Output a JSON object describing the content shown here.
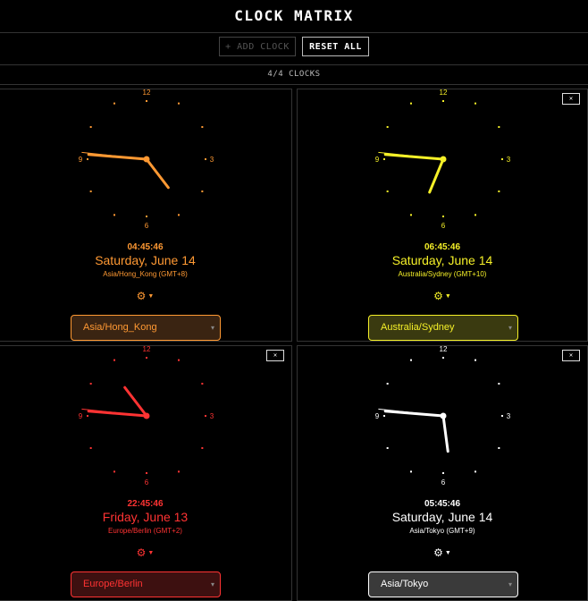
{
  "app": {
    "title": "CLOCK MATRIX"
  },
  "toolbar": {
    "add_label": "+ ADD CLOCK",
    "reset_label": "RESET ALL"
  },
  "status": {
    "count_text": "4/4 CLOCKS"
  },
  "clocks": [
    {
      "time": "04:45:46",
      "date": "Saturday, June 14",
      "zone_label": "Asia/Hong_Kong (GMT+8)",
      "selected_zone": "Asia/Hong_Kong",
      "color": "#ff9933",
      "sel_bg": "#3a2412",
      "hour": 4,
      "minute": 45,
      "second": 46,
      "numerals": {
        "n12": "12",
        "n3": "3",
        "n6": "6",
        "n9": "9"
      }
    },
    {
      "time": "06:45:46",
      "date": "Saturday, June 14",
      "zone_label": "Australia/Sydney (GMT+10)",
      "selected_zone": "Australia/Sydney",
      "color": "#f5f028",
      "sel_bg": "#3a3a10",
      "hour": 6,
      "minute": 45,
      "second": 46,
      "close_label": "✕",
      "numerals": {
        "n12": "12",
        "n3": "3",
        "n6": "6",
        "n9": "9"
      }
    },
    {
      "time": "22:45:46",
      "date": "Friday, June 13",
      "zone_label": "Europe/Berlin (GMT+2)",
      "selected_zone": "Europe/Berlin",
      "color": "#ff3333",
      "sel_bg": "#3d1010",
      "hour": 22,
      "minute": 45,
      "second": 46,
      "close_label": "✕",
      "numerals": {
        "n12": "12",
        "n3": "3",
        "n6": "6",
        "n9": "9"
      }
    },
    {
      "time": "05:45:46",
      "date": "Saturday, June 14",
      "zone_label": "Asia/Tokyo (GMT+9)",
      "selected_zone": "Asia/Tokyo",
      "color": "#ffffff",
      "sel_bg": "#3a3a3a",
      "hour": 5,
      "minute": 45,
      "second": 46,
      "close_label": "✕",
      "numerals": {
        "n12": "12",
        "n3": "3",
        "n6": "6",
        "n9": "9"
      }
    }
  ],
  "icons": {
    "settings": "gear-icon",
    "dropdown": "chevron-down-icon"
  }
}
